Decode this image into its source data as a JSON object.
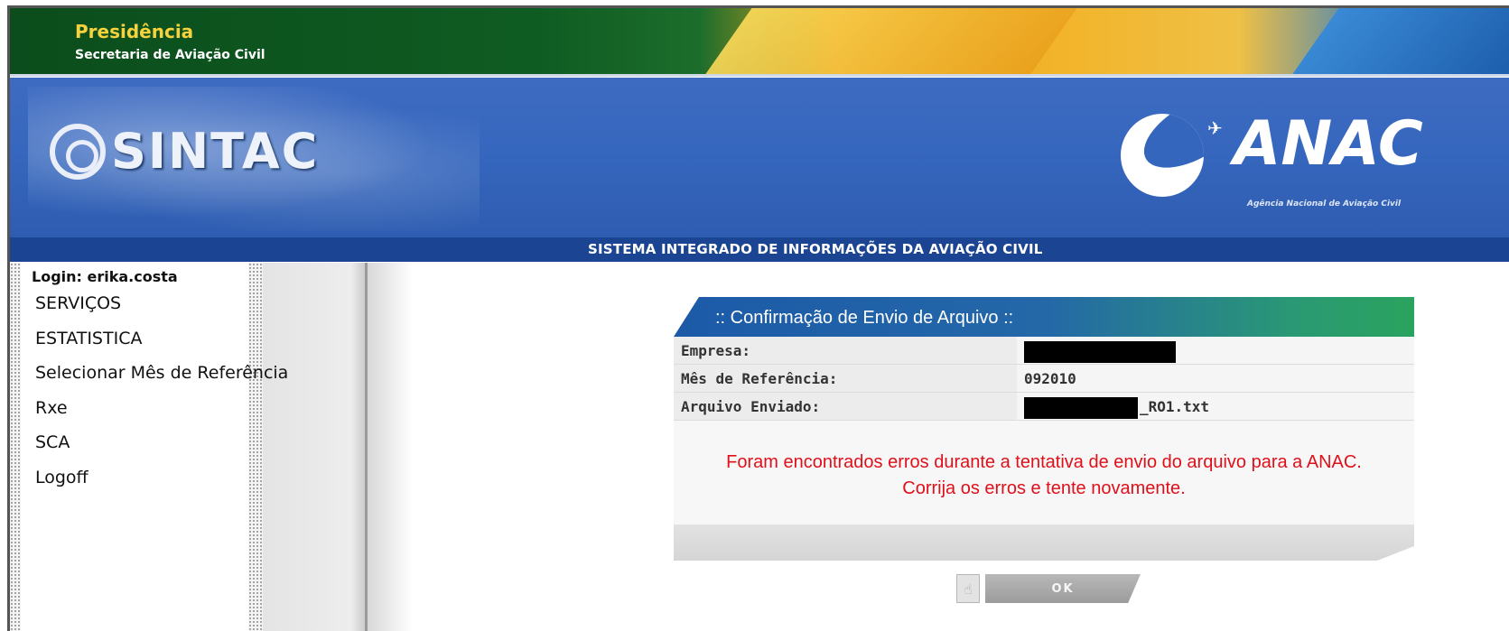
{
  "header": {
    "presidency_title": "Presidência",
    "presidency_subtitle": "Secretaria de Aviação Civil"
  },
  "banner": {
    "system_logo": "SINTAC",
    "agency_logo": "ANAC",
    "agency_name": "Agência Nacional de Aviação Civil",
    "system_full_name": "SISTEMA INTEGRADO DE INFORMAÇÕES DA AVIAÇÃO CIVIL"
  },
  "sidebar": {
    "login_label": "Login: erika.costa",
    "items": [
      {
        "label": "SERVIÇOS"
      },
      {
        "label": "ESTATISTICA"
      },
      {
        "label": "Selecionar Mês de Referência"
      },
      {
        "label": "Rxe"
      },
      {
        "label": "SCA"
      },
      {
        "label": "Logoff"
      }
    ]
  },
  "confirmation": {
    "title": ":: Confirmação de Envio de Arquivo ::",
    "rows": [
      {
        "label": "Empresa:",
        "value": ""
      },
      {
        "label": "Mês de Referência:",
        "value": "092010"
      },
      {
        "label": "Arquivo Enviado:",
        "value": "_RO1.txt"
      }
    ],
    "error_line1": "Foram encontrados erros durante a tentativa de envio do arquivo para a ANAC.",
    "error_line2": "Corrija os erros e tente novamente."
  },
  "actions": {
    "ok_label": "OK"
  },
  "colors": {
    "banner_blue": "#3566bd",
    "strip_blue": "#1b4592",
    "error_red": "#e0101a",
    "presidency_yellow": "#f7d23c"
  },
  "icons": {
    "system_logo": "sintac-logo",
    "agency_logo": "anac-plane-logo",
    "ok_icon": "hand-pointer-icon"
  }
}
